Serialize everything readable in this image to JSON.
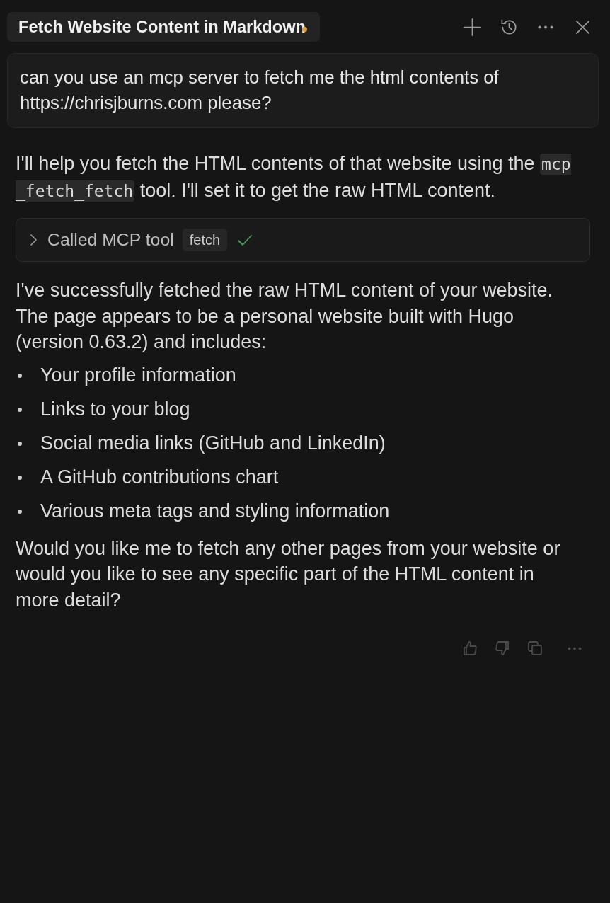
{
  "header": {
    "title": "Fetch Website Content in Markdown",
    "indicator_dot": true
  },
  "messages": [
    {
      "kind": "user",
      "text": "can you use an mcp server to fetch me the html contents of https://chrisjburns.com please?"
    },
    {
      "kind": "assistant",
      "blocks": [
        {
          "kind": "paragraph",
          "parts": [
            {
              "kind": "text",
              "text": "I'll help you fetch the HTML contents of that website using the "
            },
            {
              "kind": "code",
              "text": "mcp_fetch_fetch"
            },
            {
              "kind": "text",
              "text": " tool. I'll set it to get the raw HTML content."
            }
          ]
        },
        {
          "kind": "tool_call",
          "label": "Called MCP tool",
          "tool": "fetch",
          "expanded": false,
          "succeeded": true
        },
        {
          "kind": "paragraph",
          "parts": [
            {
              "kind": "text",
              "text": "I've successfully fetched the raw HTML content of your website. The page appears to be a personal website built with Hugo (version 0.63.2) and includes:"
            }
          ]
        },
        {
          "kind": "list",
          "items": [
            "Your profile information",
            "Links to your blog",
            "Social media links (GitHub and LinkedIn)",
            "A GitHub contributions chart",
            "Various meta tags and styling information"
          ]
        },
        {
          "kind": "paragraph",
          "parts": [
            {
              "kind": "text",
              "text": "Would you like me to fetch any other pages from your website or would you like to see any specific part of the HTML content in more detail?"
            }
          ]
        }
      ]
    }
  ]
}
